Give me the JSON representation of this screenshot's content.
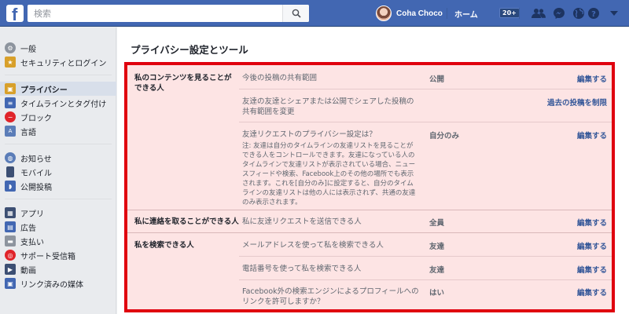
{
  "topbar": {
    "logo_letter": "f",
    "search_placeholder": "検索",
    "profile_name": "Coha Choco",
    "home_label": "ホーム",
    "home_badge": "20+",
    "icons": [
      "friends-icon",
      "messenger-icon",
      "globe-icon",
      "help-icon",
      "dropdown-caret-icon"
    ]
  },
  "sidebar": {
    "groups": [
      [
        {
          "label": "一般",
          "icon": "gear-icon"
        },
        {
          "label": "セキュリティとログイン",
          "icon": "shield-icon"
        }
      ],
      [
        {
          "label": "プライバシー",
          "icon": "lock-icon",
          "active": true
        },
        {
          "label": "タイムラインとタグ付け",
          "icon": "timeline-icon"
        },
        {
          "label": "ブロック",
          "icon": "block-icon"
        },
        {
          "label": "言語",
          "icon": "language-icon"
        }
      ],
      [
        {
          "label": "お知らせ",
          "icon": "globe-icon"
        },
        {
          "label": "モバイル",
          "icon": "mobile-icon"
        },
        {
          "label": "公開投稿",
          "icon": "rss-icon"
        }
      ],
      [
        {
          "label": "アプリ",
          "icon": "apps-icon"
        },
        {
          "label": "広告",
          "icon": "ads-icon"
        },
        {
          "label": "支払い",
          "icon": "card-icon"
        },
        {
          "label": "サポート受信箱",
          "icon": "lifebuoy-icon"
        },
        {
          "label": "動画",
          "icon": "film-icon"
        },
        {
          "label": "リンク済みの媒体",
          "icon": "linked-icon"
        }
      ]
    ]
  },
  "main": {
    "title": "プライバシー設定とツール",
    "sections": [
      {
        "label": "私のコンテンツを見ることができる人",
        "rows": [
          {
            "question": "今後の投稿の共有範囲",
            "value": "公開",
            "action": "編集する"
          },
          {
            "question": "友達の友達とシェアまたは公開でシェアした投稿の共有範囲を変更",
            "value": "",
            "action": "過去の投稿を制限"
          },
          {
            "question": "友達リクエストのプライバシー設定は？",
            "note": "注: 友達は自分のタイムラインの友達リストを見ることができる人をコントロールできます。友達になっている人のタイムラインで友達リストが表示されている場合、ニュースフィードや検索、Facebook上のその他の場所でも表示されます。これを[自分のみ]に設定すると、自分のタイムラインの友達リストは他の人には表示されず、共通の友達のみ表示されます。",
            "value": "自分のみ",
            "action": "編集する"
          }
        ]
      },
      {
        "label": "私に連絡を取ることができる人",
        "rows": [
          {
            "question": "私に友達リクエストを送信できる人",
            "value": "全員",
            "action": "編集する"
          }
        ]
      },
      {
        "label": "私を検索できる人",
        "rows": [
          {
            "question": "メールアドレスを使って私を検索できる人",
            "value": "友達",
            "action": "編集する"
          },
          {
            "question": "電話番号を使って私を検索できる人",
            "value": "友達",
            "action": "編集する"
          },
          {
            "question": "Facebook外の検索エンジンによるプロフィールへのリンクを許可しますか？",
            "value": "はい",
            "action": "編集する"
          }
        ]
      }
    ]
  },
  "colors": {
    "brand": "#4267b2",
    "highlight_border": "#e0000e",
    "highlight_fill": "#fde4e4",
    "link": "#365899"
  }
}
